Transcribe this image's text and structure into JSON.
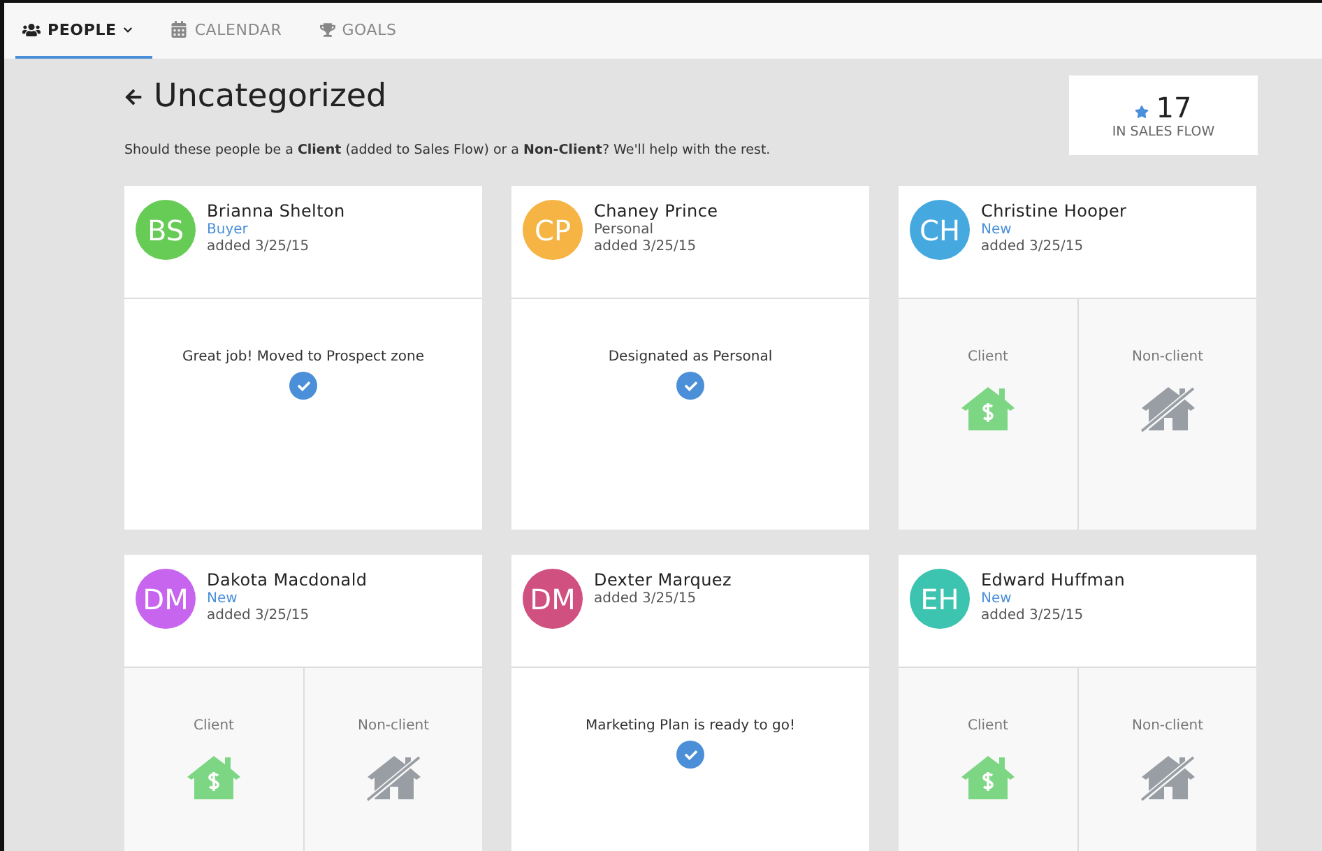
{
  "nav": {
    "tabs": [
      {
        "label": "PEOPLE",
        "selected": true,
        "dropdown": true
      },
      {
        "label": "CALENDAR",
        "selected": false,
        "dropdown": false
      },
      {
        "label": "GOALS",
        "selected": false,
        "dropdown": false
      }
    ]
  },
  "header": {
    "title": "Uncategorized",
    "subtitle": "Should these people be a **Client** (added to Sales Flow) or a **Non-Client**? We'll help with the rest."
  },
  "sales_flow": {
    "count": "17",
    "label": "IN SALES FLOW"
  },
  "people": [
    {
      "initials": "BS",
      "color": "#66cc55",
      "name": "Brianna Shelton",
      "tag": {
        "text": "Buyer",
        "color": "#4a90d9"
      },
      "added": "added 3/25/15",
      "kind": "done",
      "message": "Great job! Moved to Prospect zone"
    },
    {
      "initials": "CP",
      "color": "#f5b443",
      "name": "Chaney Prince",
      "tag": {
        "text": "Personal",
        "color": "#555555"
      },
      "added": "added 3/25/15",
      "kind": "done",
      "message": "Designated as Personal"
    },
    {
      "initials": "CH",
      "color": "#45a9e0",
      "name": "Christine Hooper",
      "tag": {
        "text": "New",
        "color": "#4a90d9"
      },
      "added": "added 3/25/15",
      "kind": "choose",
      "options": [
        "Client",
        "Non-client"
      ]
    },
    {
      "initials": "DM",
      "color": "#c765ee",
      "name": "Dakota Macdonald",
      "tag": {
        "text": "New",
        "color": "#4a90d9"
      },
      "added": "added 3/25/15",
      "kind": "choose",
      "options": [
        "Client",
        "Non-client"
      ]
    },
    {
      "initials": "DM",
      "color": "#d05080",
      "name": "Dexter Marquez",
      "added": "added 3/25/15",
      "kind": "done",
      "message": "Marketing Plan is ready to go!"
    },
    {
      "initials": "EH",
      "color": "#3cc4b0",
      "name": "Edward Huffman",
      "tag": {
        "text": "New",
        "color": "#4a90d9"
      },
      "added": "added 3/25/15",
      "kind": "choose",
      "options": [
        "Client",
        "Non-client"
      ]
    }
  ]
}
